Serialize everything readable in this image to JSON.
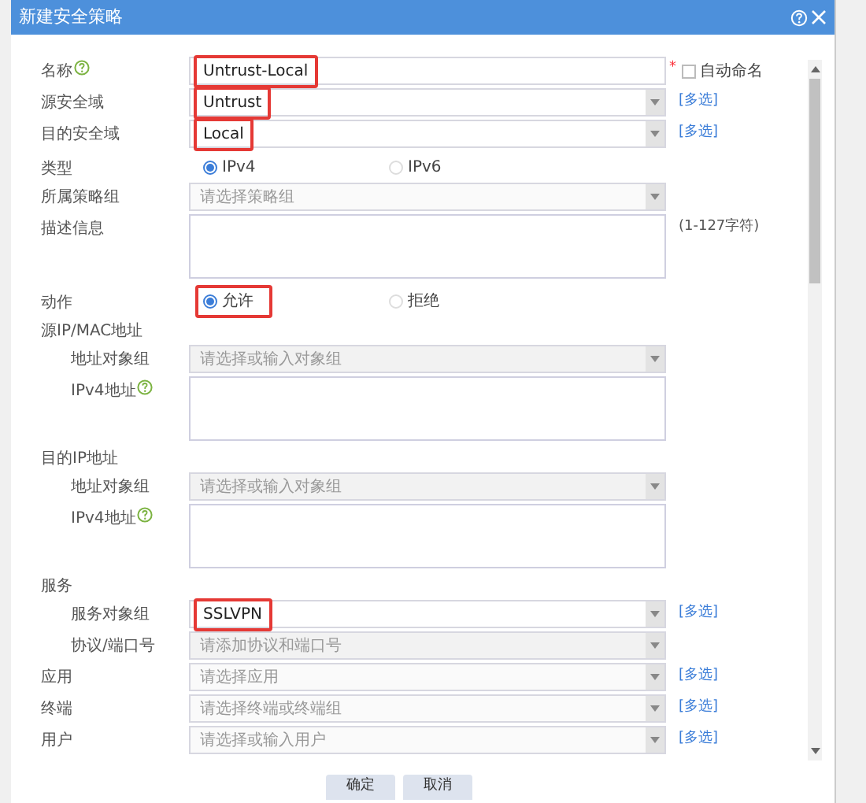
{
  "dialog": {
    "title": "新建安全策略"
  },
  "rows": [
    {
      "kind": "text",
      "label": "名称",
      "help": true,
      "value": "Untrust-Local",
      "highlighted": true,
      "required_mark": "*",
      "checkbox": {
        "label": "自动命名",
        "checked": false
      }
    },
    {
      "kind": "select",
      "label": "源安全域",
      "value": "Untrust",
      "highlighted": true,
      "link": "[多选]"
    },
    {
      "kind": "select",
      "label": "目的安全域",
      "value": "Local",
      "highlighted": true,
      "link": "[多选]"
    },
    {
      "kind": "radio",
      "label": "类型",
      "options": [
        {
          "label": "IPv4",
          "selected": true,
          "highlighted": false
        },
        {
          "label": "IPv6",
          "selected": false,
          "highlighted": false
        }
      ]
    },
    {
      "kind": "select",
      "label": "所属策略组",
      "placeholder": "请选择策略组"
    },
    {
      "kind": "textarea",
      "label": "描述信息",
      "note": "(1-127字符)"
    },
    {
      "kind": "radio",
      "label": "动作",
      "options": [
        {
          "label": "允许",
          "selected": true,
          "highlighted": true
        },
        {
          "label": "拒绝",
          "selected": false,
          "highlighted": false
        }
      ]
    },
    {
      "kind": "section",
      "label": "源IP/MAC地址",
      "children": [
        {
          "kind": "select",
          "label": "地址对象组",
          "placeholder": "请选择或输入对象组",
          "disabled": true
        },
        {
          "kind": "textarea",
          "label": "IPv4地址",
          "help": true
        }
      ]
    },
    {
      "kind": "section",
      "label": "目的IP地址",
      "children": [
        {
          "kind": "select",
          "label": "地址对象组",
          "placeholder": "请选择或输入对象组",
          "disabled": true
        },
        {
          "kind": "textarea",
          "label": "IPv4地址",
          "help": true
        }
      ]
    },
    {
      "kind": "section",
      "label": "服务",
      "children": [
        {
          "kind": "select",
          "label": "服务对象组",
          "value": "SSLVPN",
          "highlighted": true,
          "link": "[多选]"
        },
        {
          "kind": "select",
          "label": "协议/端口号",
          "placeholder": "请添加协议和端口号",
          "disabled": true
        }
      ]
    },
    {
      "kind": "select",
      "label": "应用",
      "placeholder": "请选择应用",
      "link": "[多选]"
    },
    {
      "kind": "select",
      "label": "终端",
      "placeholder": "请选择终端或终端组",
      "link": "[多选]"
    },
    {
      "kind": "select",
      "label": "用户",
      "placeholder": "请选择或输入用户",
      "link": "[多选]"
    }
  ],
  "buttons": [
    "确定",
    "取消"
  ]
}
